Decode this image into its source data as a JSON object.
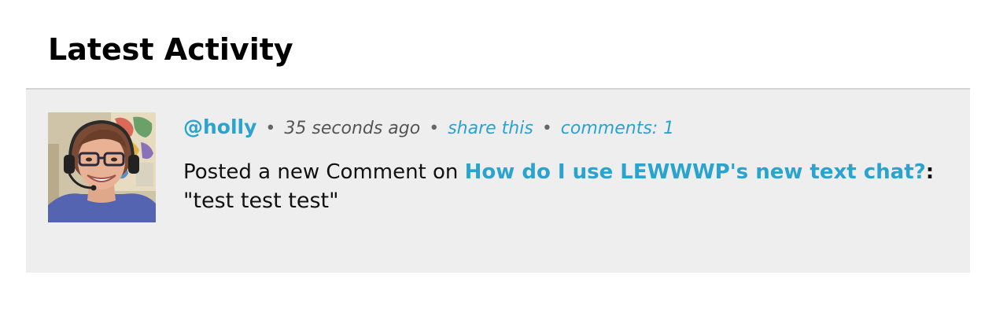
{
  "section": {
    "title": "Latest Activity"
  },
  "activity": {
    "username": "@holly",
    "separator": "•",
    "timestamp": "35 seconds ago",
    "share_label": "share this",
    "comments_label": "comments: 1",
    "action_text": "Posted a new Comment on ",
    "post_title": "How do I use LEWWWP's new text chat?",
    "colon": ":",
    "quote": "\"test test test\""
  },
  "colors": {
    "link": "#2aa3cf",
    "card_background": "#eeeeee"
  },
  "icons": {
    "avatar": "user-avatar-photo"
  }
}
